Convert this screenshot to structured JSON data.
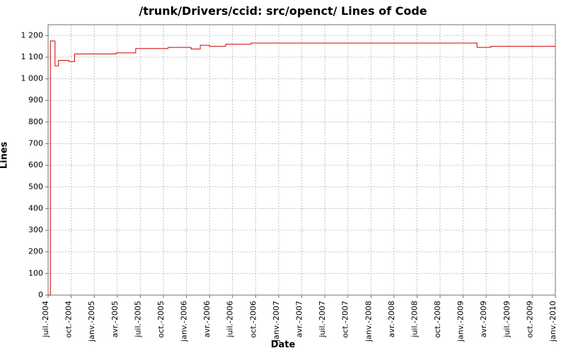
{
  "chart_data": {
    "type": "line",
    "title": "/trunk/Drivers/ccid: src/openct/ Lines of Code",
    "xlabel": "Date",
    "ylabel": "Lines",
    "ylim": [
      0,
      1250
    ],
    "y_ticks": [
      0,
      100,
      200,
      300,
      400,
      500,
      600,
      700,
      800,
      900,
      1000,
      1100,
      1200
    ],
    "y_tick_labels": [
      "0",
      "100",
      "200",
      "300",
      "400",
      "500",
      "600",
      "700",
      "800",
      "900",
      "1 000",
      "1 100",
      "1 200"
    ],
    "x_tick_labels": [
      "juil.-2004",
      "oct.-2004",
      "janv.-2005",
      "avr.-2005",
      "juil.-2005",
      "oct.-2005",
      "janv.-2006",
      "avr.-2006",
      "juil.-2006",
      "oct.-2006",
      "janv.-2007",
      "avr.-2007",
      "juil.-2007",
      "oct.-2007",
      "janv.-2008",
      "avr.-2008",
      "juil.-2008",
      "oct.-2008",
      "janv.-2009",
      "avr.-2009",
      "juil.-2009",
      "oct.-2009",
      "janv.-2010"
    ],
    "series": [
      {
        "name": "src/openct/",
        "color": "#d00000",
        "points": [
          {
            "xi": 0.0,
            "y": 0
          },
          {
            "xi": 0.1,
            "y": 0
          },
          {
            "xi": 0.1,
            "y": 1175
          },
          {
            "xi": 0.3,
            "y": 1175
          },
          {
            "xi": 0.3,
            "y": 1060
          },
          {
            "xi": 0.45,
            "y": 1060
          },
          {
            "xi": 0.45,
            "y": 1085
          },
          {
            "xi": 0.9,
            "y": 1085
          },
          {
            "xi": 0.9,
            "y": 1080
          },
          {
            "xi": 1.15,
            "y": 1080
          },
          {
            "xi": 1.15,
            "y": 1115
          },
          {
            "xi": 2.95,
            "y": 1115
          },
          {
            "xi": 2.95,
            "y": 1120
          },
          {
            "xi": 3.8,
            "y": 1120
          },
          {
            "xi": 3.8,
            "y": 1140
          },
          {
            "xi": 5.2,
            "y": 1140
          },
          {
            "xi": 5.2,
            "y": 1145
          },
          {
            "xi": 6.2,
            "y": 1145
          },
          {
            "xi": 6.2,
            "y": 1138
          },
          {
            "xi": 6.6,
            "y": 1138
          },
          {
            "xi": 6.6,
            "y": 1155
          },
          {
            "xi": 7.0,
            "y": 1155
          },
          {
            "xi": 7.0,
            "y": 1150
          },
          {
            "xi": 7.7,
            "y": 1150
          },
          {
            "xi": 7.7,
            "y": 1160
          },
          {
            "xi": 8.8,
            "y": 1160
          },
          {
            "xi": 8.8,
            "y": 1165
          },
          {
            "xi": 18.6,
            "y": 1165
          },
          {
            "xi": 18.6,
            "y": 1145
          },
          {
            "xi": 19.2,
            "y": 1145
          },
          {
            "xi": 19.2,
            "y": 1150
          },
          {
            "xi": 22.0,
            "y": 1150
          }
        ]
      }
    ]
  }
}
